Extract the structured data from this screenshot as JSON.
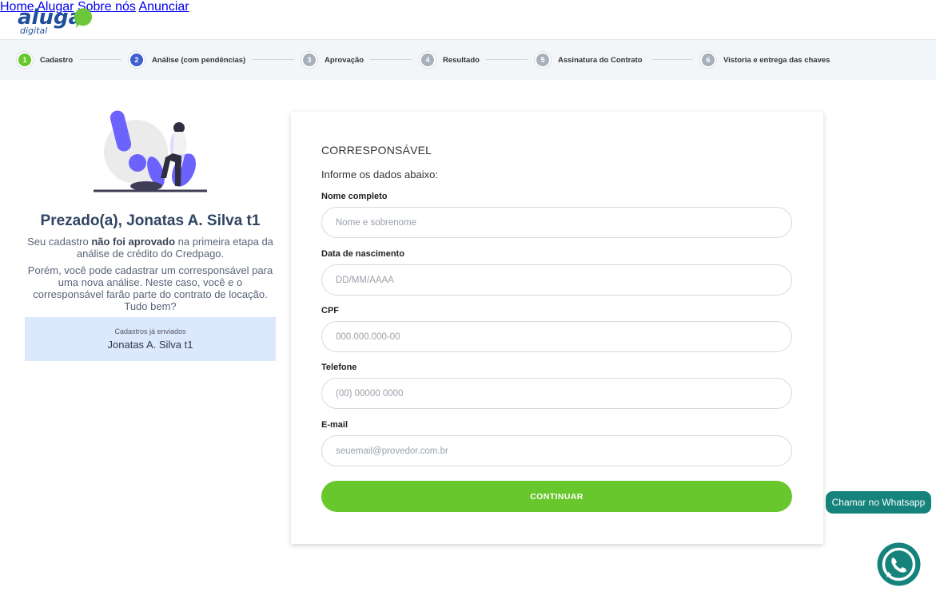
{
  "brand": {
    "logo_main": "aluga",
    "logo_sub": "digital"
  },
  "nav": [
    "Home",
    "Alugar",
    "Sobre nós",
    "Anunciar"
  ],
  "steps": [
    {
      "num": "1",
      "label": "Cadastro",
      "color": "#68c72c"
    },
    {
      "num": "2",
      "label": "Análise (com pendências)",
      "color": "#3d5fd0"
    },
    {
      "num": "3",
      "label": "Aprovação",
      "color": "#a7afbb"
    },
    {
      "num": "4",
      "label": "Resultado",
      "color": "#a7afbb"
    },
    {
      "num": "5",
      "label": "Assinatura do Contrato",
      "color": "#a7afbb"
    },
    {
      "num": "6",
      "label": "Vistoria e entrega das chaves",
      "color": "#a7afbb"
    }
  ],
  "left": {
    "greeting": "Prezado(a), Jonatas A. Silva t1",
    "msg1_a": "Seu cadastro ",
    "msg1_b": "não foi aprovado",
    "msg1_c": " na primeira etapa da análise de crédito do Credpago.",
    "msg2": "Porém, você pode cadastrar um corresponsável para uma nova análise. Neste caso, você e o corresponsável farão parte do contrato de locação. Tudo bem?",
    "sent_title": "Cadastros já enviados",
    "sent_name": "Jonatas A. Silva t1"
  },
  "form": {
    "title": "CORRESPONSÁVEL",
    "subtitle": "Informe os dados abaixo:",
    "fields": [
      {
        "label": "Nome completo",
        "placeholder": "Nome e sobrenome",
        "value": ""
      },
      {
        "label": "Data de nascimento",
        "placeholder": "DD/MM/AAAA",
        "value": ""
      },
      {
        "label": "CPF",
        "placeholder": "000.000.000-00",
        "value": ""
      },
      {
        "label": "Telefone",
        "placeholder": "(00) 00000 0000",
        "value": ""
      },
      {
        "label": "E-mail",
        "placeholder": "seuemail@provedor.com.br",
        "value": ""
      }
    ],
    "submit": "CONTINUAR"
  },
  "whatsapp": {
    "label": "Chamar no Whatsapp"
  },
  "colors": {
    "accent_green": "#68c72c",
    "active_blue": "#3d5fd0",
    "title_navy": "#2f4463",
    "whatsapp": "#15837b"
  }
}
